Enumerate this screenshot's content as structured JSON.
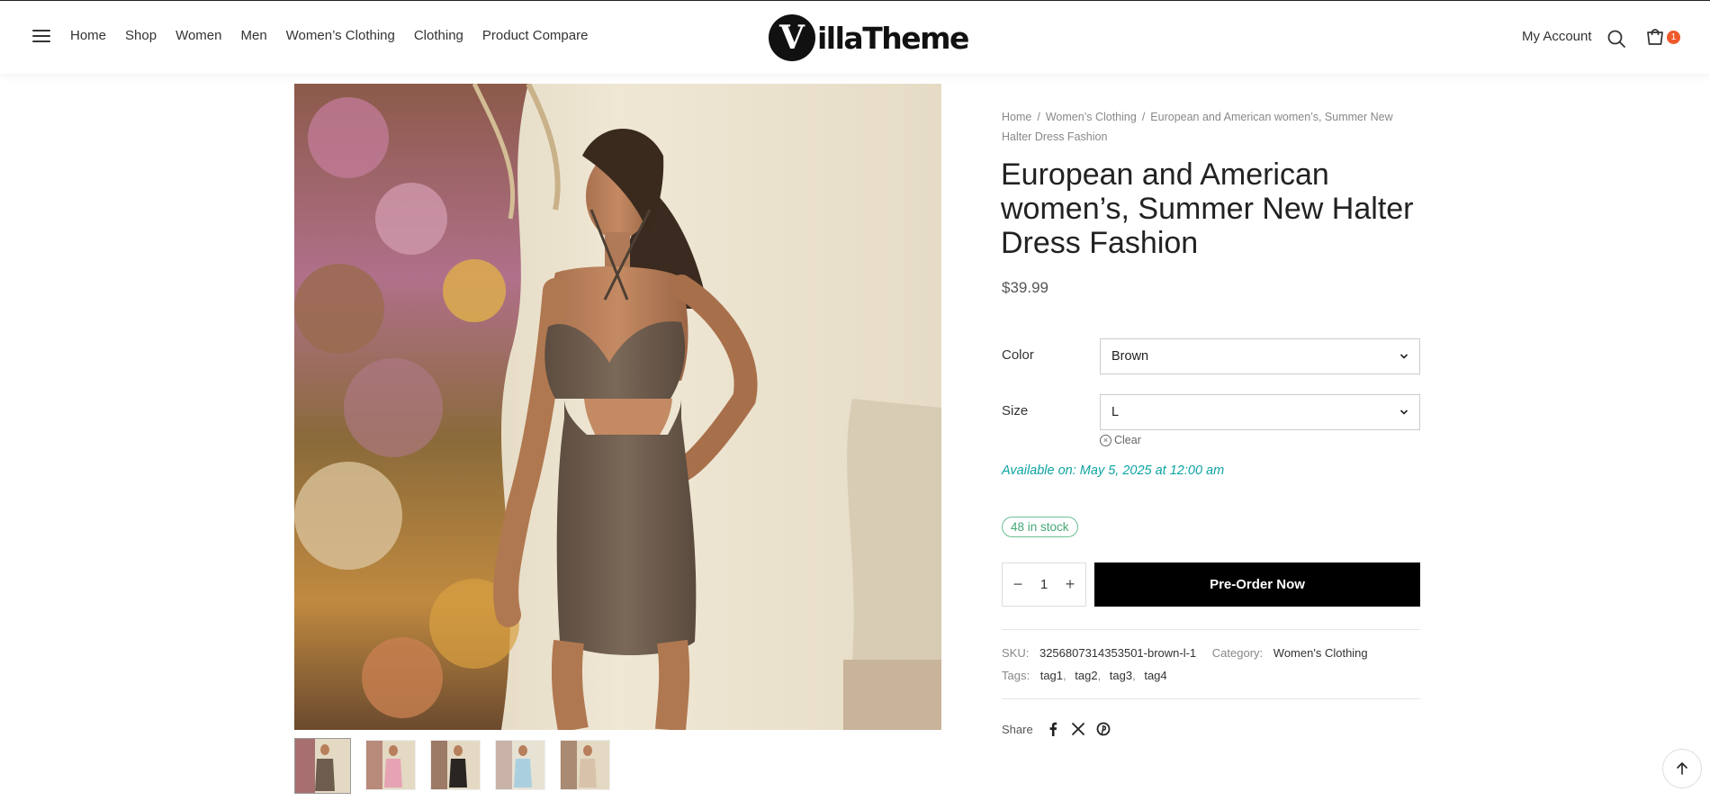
{
  "header": {
    "nav": [
      "Home",
      "Shop",
      "Women",
      "Men",
      "Women’s Clothing",
      "Clothing",
      "Product Compare"
    ],
    "logo_letter": "V",
    "logo_text": "illaTheme",
    "account_label": "My Account",
    "cart_count": "1"
  },
  "product": {
    "breadcrumb": {
      "home": "Home",
      "category": "Women’s Clothing",
      "current": "European and American women’s, Summer New Halter Dress Fashion"
    },
    "title": "European and American women’s, Summer New Halter Dress Fashion",
    "price": "$39.99",
    "color_label": "Color",
    "color_value": "Brown",
    "size_label": "Size",
    "size_value": "L",
    "clear_label": "Clear",
    "available_text": "Available on: May 5, 2025 at 12:00 am",
    "stock_text": "48 in stock",
    "quantity": "1",
    "preorder_label": "Pre-Order Now",
    "sku_label": "SKU:",
    "sku_value": "3256807314353501-brown-l-1",
    "category_label": "Category:",
    "category_value": "Women's Clothing",
    "tags_label": "Tags:",
    "tags": [
      "tag1",
      "tag2",
      "tag3",
      "tag4"
    ],
    "share_label": "Share"
  },
  "colors": {
    "accent_teal": "#0fa3a3",
    "stock_green": "#45a878",
    "cart_badge": "#f0592a",
    "button_black": "#000000",
    "dress_brown": "#6e5d4f"
  }
}
